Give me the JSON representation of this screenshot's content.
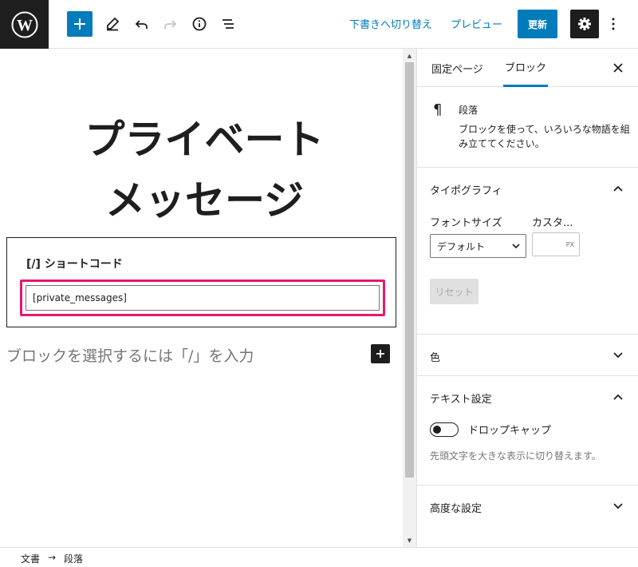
{
  "toolbar": {
    "switch_to_draft": "下書きへ切り替え",
    "preview": "プレビュー",
    "update": "更新"
  },
  "editor": {
    "title_line1": "プライベート",
    "title_line2": "メッセージ",
    "shortcode_label": "[/]  ショートコード",
    "shortcode_value": "[private_messages]",
    "block_placeholder": "ブロックを選択するには「/」を入力"
  },
  "sidebar": {
    "tabs": [
      "固定ページ",
      "ブロック"
    ],
    "active_tab": "ブロック",
    "block_card": {
      "title": "段落",
      "description": "ブロックを使って、いろいろな物語を組み立ててください。"
    },
    "typography": {
      "heading": "タイポグラフィ",
      "font_size_label": "フォントサイズ",
      "custom_label": "カスタ...",
      "font_size_value": "デフォルト",
      "unit": "PX",
      "reset": "リセット"
    },
    "color": {
      "heading": "色"
    },
    "text_settings": {
      "heading": "テキスト設定",
      "drop_cap_label": "ドロップキャップ",
      "drop_cap_enabled": false,
      "help": "先頭文字を大きな表示に切り替えます。"
    },
    "advanced": {
      "heading": "高度な設定"
    }
  },
  "footer": {
    "breadcrumbs": [
      "文書",
      "段落"
    ],
    "separator": "→"
  },
  "colors": {
    "accent": "#007cba",
    "dark": "#1e1e1e",
    "highlight": "#e6186c"
  },
  "icons": [
    "wordpress-logo-icon",
    "plus-icon",
    "pencil-icon",
    "undo-icon",
    "redo-icon",
    "info-icon",
    "list-view-icon",
    "gear-icon",
    "more-vertical-icon",
    "close-icon",
    "pilcrow-icon",
    "chevron-up-icon",
    "chevron-down-icon"
  ]
}
